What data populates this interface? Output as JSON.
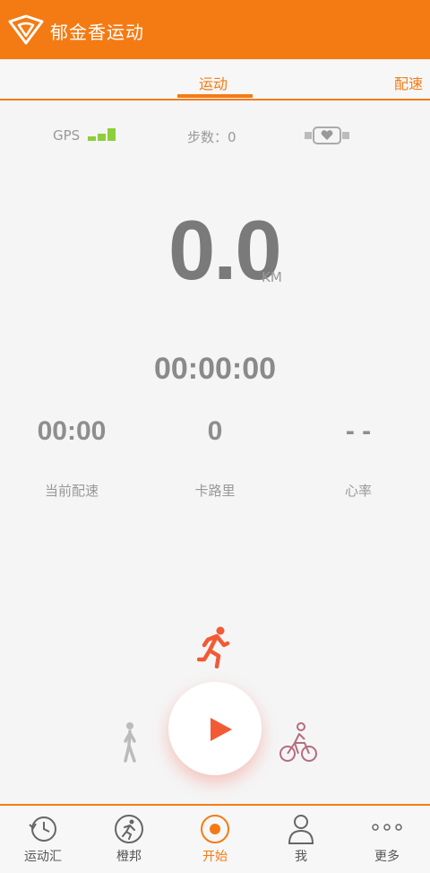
{
  "header": {
    "title": "郁金香运动",
    "logo_icon": "tulip-logo-icon"
  },
  "tabs": [
    {
      "label": "运动",
      "active": true
    },
    {
      "label": "配速",
      "active": false
    }
  ],
  "status": {
    "gps_label": "GPS",
    "steps": "步数：0",
    "heart_icon": "heart-band-icon"
  },
  "distance": {
    "value": "0.0",
    "unit": "KM"
  },
  "duration": "00:00:00",
  "metrics": [
    {
      "value": "00:00",
      "label": "当前配速"
    },
    {
      "value": "0",
      "label": "卡路里"
    },
    {
      "value": "- -",
      "label": "心率"
    }
  ],
  "modes": {
    "run_icon": "running-icon",
    "walk_icon": "walking-icon",
    "bike_icon": "cycling-icon",
    "start_icon": "play-icon"
  },
  "nav": [
    {
      "label": "运动汇",
      "icon": "history-icon",
      "active": false
    },
    {
      "label": "橙邦",
      "icon": "runner-badge-icon",
      "active": false
    },
    {
      "label": "开始",
      "icon": "record-icon",
      "active": true
    },
    {
      "label": "我",
      "icon": "person-icon",
      "active": false
    },
    {
      "label": "更多",
      "icon": "more-dots-icon",
      "active": false
    }
  ],
  "colors": {
    "accent": "#f47b14",
    "play": "#f25a35"
  }
}
